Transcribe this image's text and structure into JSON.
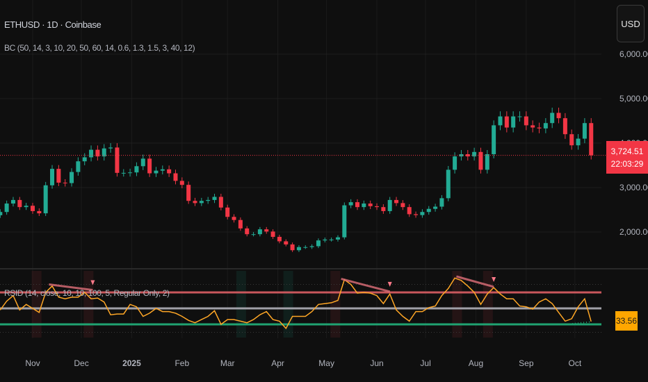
{
  "header": {
    "title": "ETHUSD · 1D · Coinbase",
    "indicator_main": "BC (50, 14, 3, 10, 20, 50, 60, 14, 0.6, 1.3, 1.5, 3, 40, 12)",
    "indicator_rsi": "RSID (14, close, 10, 10, 100, 5, Regular Only, 2)",
    "currency_button": "USD"
  },
  "price_tag": {
    "price": "3,724.51",
    "countdown": "22:03:29",
    "color": "#f23645"
  },
  "rsi_tag": {
    "value": "33.56",
    "color": "#ffa600"
  },
  "colors": {
    "up": "#22ab94",
    "down": "#f23645",
    "rsi_line": "#ffa726",
    "overbought": "#c9575c",
    "midline": "#a0a0a8",
    "oversold": "#1fa372",
    "divergence": "#e0707a",
    "background": "#0f0f0f"
  },
  "chart_data": [
    {
      "type": "candlestick",
      "title": "ETHUSD · 1D · Coinbase",
      "yaxis": {
        "ticks": [
          "2,000.00",
          "3,000.00",
          "4,000.00",
          "5,000.00",
          "6,000.00"
        ],
        "tick_values": [
          2000,
          3000,
          4000,
          5000,
          6000
        ],
        "range": [
          1300,
          6800
        ]
      },
      "xaxis": {
        "labels": [
          "Nov",
          "Dec",
          "2025",
          "Feb",
          "Mar",
          "Apr",
          "May",
          "Jun",
          "Jul",
          "Aug",
          "Sep",
          "Oct"
        ],
        "label_dates": [
          "2024-11-01",
          "2024-12-01",
          "2025-01-01",
          "2025-02-01",
          "2025-03-01",
          "2025-04-01",
          "2025-05-01",
          "2025-06-01",
          "2025-07-01",
          "2025-08-01",
          "2025-09-01",
          "2025-10-01"
        ]
      },
      "grid": true,
      "series_start": "2024-10-12",
      "series_step_days": 4,
      "close": [
        2450,
        2640,
        2720,
        2560,
        2590,
        2470,
        2420,
        3050,
        3420,
        3110,
        3100,
        3350,
        3590,
        3680,
        3850,
        3700,
        3880,
        3900,
        3330,
        3330,
        3340,
        3480,
        3650,
        3320,
        3380,
        3410,
        3320,
        3150,
        3060,
        2700,
        2650,
        2700,
        2720,
        2790,
        2550,
        2340,
        2270,
        2080,
        1950,
        1950,
        2060,
        2010,
        1890,
        1790,
        1720,
        1590,
        1660,
        1660,
        1680,
        1810,
        1830,
        1830,
        1880,
        2600,
        2670,
        2560,
        2640,
        2580,
        2560,
        2470,
        2720,
        2650,
        2560,
        2400,
        2380,
        2450,
        2520,
        2570,
        2760,
        3400,
        3700,
        3750,
        3700,
        3800,
        3400,
        3750,
        4400,
        4600,
        4350,
        4600,
        4600,
        4400,
        4350,
        4330,
        4450,
        4680,
        4560,
        4200,
        3950,
        4100,
        4450,
        3724.51
      ],
      "last_price": 3724.51
    },
    {
      "type": "line",
      "title": "RSID (14, close, 10, 10, 100, 5, Regular Only, 2)",
      "levels": {
        "upper_dotted": 80,
        "overbought": 70,
        "mid": 50,
        "oversold": 30,
        "lower_dotted": 20
      },
      "yrange": [
        10,
        95
      ],
      "series_start": "2024-10-12",
      "series_step_days": 4,
      "values": [
        48,
        59,
        66,
        48,
        55,
        50,
        45,
        70,
        78,
        64,
        62,
        64,
        64,
        70,
        62,
        63,
        58,
        42,
        43,
        43,
        55,
        52,
        40,
        44,
        50,
        46,
        46,
        44,
        40,
        35,
        32,
        36,
        40,
        47,
        30,
        36,
        36,
        34,
        32,
        36,
        42,
        46,
        36,
        34,
        25,
        40,
        40,
        40,
        46,
        55,
        56,
        57,
        60,
        86,
        80,
        69,
        70,
        69,
        66,
        56,
        68,
        48,
        40,
        34,
        46,
        46,
        51,
        53,
        66,
        75,
        88,
        85,
        78,
        70,
        55,
        68,
        76,
        68,
        62,
        62,
        53,
        52,
        49,
        58,
        62,
        56,
        45,
        34,
        37,
        52,
        62,
        33.56
      ],
      "bearish_divergences": [
        {
          "from": [
            "2024-11-11",
            80
          ],
          "to": [
            "2024-12-08",
            73
          ]
        },
        {
          "from": [
            "2025-05-10",
            87
          ],
          "to": [
            "2025-06-09",
            71
          ]
        },
        {
          "from": [
            "2025-07-20",
            90
          ],
          "to": [
            "2025-08-12",
            77
          ]
        }
      ],
      "bullish_divergences": [
        {
          "from": [
            "2025-09-26",
            30
          ],
          "to": [
            "2025-10-10",
            33
          ]
        }
      ]
    }
  ]
}
